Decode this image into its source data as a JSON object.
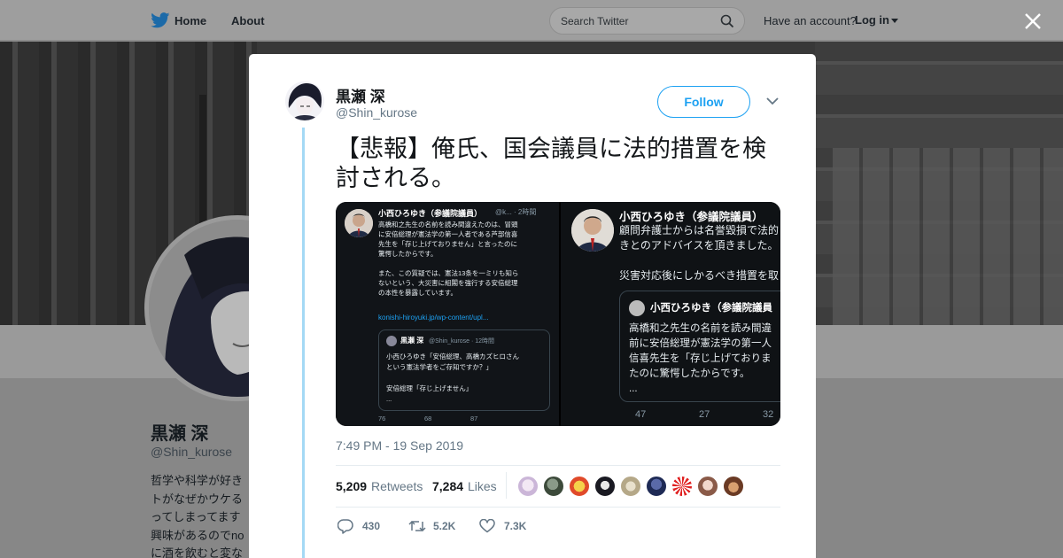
{
  "nav": {
    "home_label": "Home",
    "about_label": "About",
    "search_placeholder": "Search Twitter",
    "have_account": "Have an account?",
    "login_label": "Log in"
  },
  "profile": {
    "name": "黒瀬 深",
    "handle": "@Shin_kurose",
    "bio": "哲学や科学が好き\nトがなぜかウケる\nってしまってます\n興味があるのでno\nに酒を飲むと変な"
  },
  "tweet": {
    "author_name": "黒瀬 深",
    "author_handle": "@Shin_kurose",
    "follow_label": "Follow",
    "text": "【悲報】俺氏、国会議員に法的措置を検討される。",
    "timestamp": "7:49 PM - 19 Sep 2019",
    "retweets_count": "5,209",
    "retweets_label": "Retweets",
    "likes_count": "7,284",
    "likes_label": "Likes",
    "actions": {
      "reply": "430",
      "retweet": "5.2K",
      "like": "7.3K"
    }
  },
  "media_left": {
    "name": "小西ひろゆき（参議院議員）",
    "meta": "@k... · 2時間",
    "body": "高橋和之先生の名前を読み間違えたのは、冒頭\nに安倍総理が憲法学の第一人者である芦部信喜\n先生を「存じ上げておりません」と言ったのに\n驚愕したからです。\n\nまた、この質疑では、憲法13条を一ミリも知ら\nないという、大災害に組閣を強行する安倍総理\nの本性を暴露しています。",
    "link": "konishi-hiroyuki.jp/wp-content/upl...",
    "quote_name": "黒瀬 深",
    "quote_handle": "@Shin_kurose · 12時間",
    "quote_body": "小西ひろゆき「安倍総理、高橋カズヒロさん\nという憲法学者をご存知ですか？」\n\n安倍総理「存じ上げません」\n...",
    "reply_count": "76",
    "retweet_count": "68",
    "like_count": "87"
  },
  "media_right": {
    "name": "小西ひろゆき（参議院議員）",
    "body": "顧問弁護士からは名誉毀損で法的\nきとのアドバイスを頂きました。",
    "body2": "災害対応後にしかるべき措置を取",
    "quote_name": "小西ひろゆき（参議院議員",
    "quote_body": "高橋和之先生の名前を読み間違\n前に安倍総理が憲法学の第一人\n信喜先生を「存じ上げておりま\nたのに驚愕したからです。\n...",
    "reply_count": "47",
    "retweet_count": "27",
    "like_count": "32"
  },
  "colors": {
    "twitter_blue": "#1da1f2",
    "thread_line": "#a4d9f5",
    "muted_text": "#657786"
  },
  "icons": [
    "twitter-bird-icon",
    "search-icon",
    "close-icon",
    "chevron-down-icon",
    "reply-icon",
    "retweet-icon",
    "heart-icon"
  ]
}
